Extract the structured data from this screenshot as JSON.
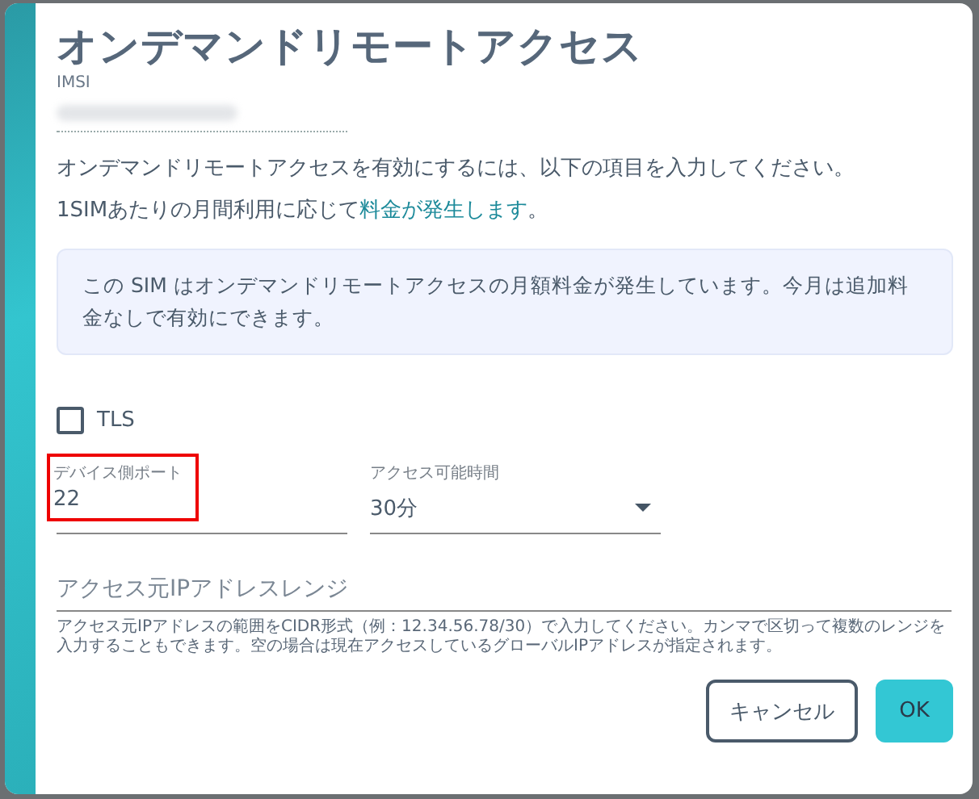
{
  "dialog": {
    "title": "オンデマンドリモートアクセス",
    "imsi_label": "IMSI",
    "intro": "オンデマンドリモートアクセスを有効にするには、以下の項目を入力してください。",
    "pricing_note": {
      "before": "1SIMあたりの月間利用に応じて",
      "link": "料金が発生します",
      "after": "。"
    },
    "notice": "この SIM はオンデマンドリモートアクセスの月額料金が発生しています。今月は追加料金なしで有効にできます。",
    "tls": {
      "label": "TLS",
      "checked": false
    },
    "port": {
      "label": "デバイス側ポート",
      "value": "22",
      "highlighted": true
    },
    "duration": {
      "label": "アクセス可能時間",
      "value": "30分"
    },
    "ip_range": {
      "placeholder": "アクセス元IPアドレスレンジ",
      "help": "アクセス元IPアドレスの範囲をCIDR形式（例：12.34.56.78/30）で入力してください。カンマで区切って複数のレンジを入力することもできます。空の場合は現在アクセスしているグローバルIPアドレスが指定されます。"
    },
    "buttons": [
      {
        "label": "キャンセル",
        "kind": "secondary"
      },
      {
        "label": "OK",
        "kind": "primary"
      }
    ]
  }
}
